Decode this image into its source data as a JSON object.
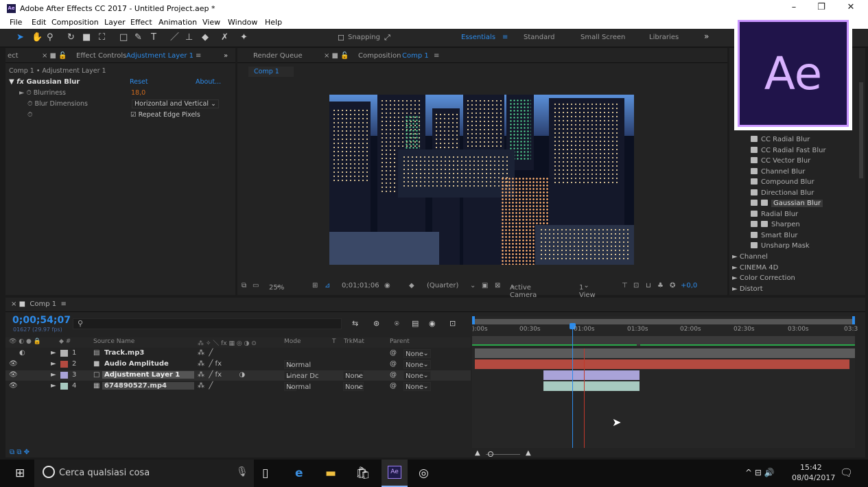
{
  "window": {
    "title": "Adobe After Effects CC 2017 - Untitled Project.aep *",
    "app_badge": "Ae",
    "min": "–",
    "max": "❐",
    "close": "✕"
  },
  "menu": [
    "File",
    "Edit",
    "Composition",
    "Layer",
    "Effect",
    "Animation",
    "View",
    "Window",
    "Help"
  ],
  "toolbar": {
    "snapping": "Snapping",
    "workspaces": [
      "Essentials",
      "Standard",
      "Small Screen",
      "Libraries"
    ],
    "overflow": "»"
  },
  "effect_controls": {
    "tab_prefix": "ect",
    "tab_label": "Effect Controls",
    "tab_layer": "Adjustment Layer 1",
    "overflow": "»",
    "breadcrumb": "Comp 1 • Adjustment Layer 1",
    "effect_name": "Gaussian Blur",
    "reset": "Reset",
    "about": "About...",
    "blurriness_label": "Blurriness",
    "blurriness_value": "18,0",
    "blur_dim_label": "Blur Dimensions",
    "blur_dim_value": "Horizontal and Vertical",
    "repeat_edge": "Repeat Edge Pixels"
  },
  "composition": {
    "render_queue": "Render Queue",
    "tab_label": "Composition",
    "comp_name": "Comp 1",
    "sub_tab": "Comp 1",
    "zoom": "25%",
    "timecode": "0;01;01;06",
    "resolution": "(Quarter)",
    "camera": "Active Camera",
    "views": "1 View",
    "exposure": "+0,0"
  },
  "effects_panel": {
    "items": [
      "CC Radial Blur",
      "CC Radial Fast Blur",
      "CC Vector Blur",
      "Channel Blur",
      "Compound Blur",
      "Directional Blur",
      "Gaussian Blur",
      "Radial Blur",
      "Sharpen",
      "Smart Blur",
      "Unsharp Mask"
    ],
    "categories": [
      "Channel",
      "CINEMA 4D",
      "Color Correction",
      "Distort"
    ]
  },
  "logo": {
    "text": "Ae"
  },
  "timeline": {
    "tab": "Comp 1",
    "timecode": "0;00;54;07",
    "frame_info": "01627 (29.97 fps)",
    "col_source": "Source Name",
    "col_mode": "Mode",
    "col_t": "T",
    "col_trkmat": "TrkMat",
    "col_parent": "Parent",
    "layers": [
      {
        "num": "1",
        "name": "Track.mp3",
        "mode": "",
        "trkmat": "",
        "parent": "None"
      },
      {
        "num": "2",
        "name": "Audio Amplitude",
        "mode": "Normal",
        "trkmat": "",
        "parent": "None"
      },
      {
        "num": "3",
        "name": "Adjustment Layer 1",
        "mode": "Linear Dc",
        "trkmat": "None",
        "parent": "None"
      },
      {
        "num": "4",
        "name": "674890527.mp4",
        "mode": "Normal",
        "trkmat": "None",
        "parent": "None"
      }
    ],
    "ruler": [
      "):00s",
      "00:30s",
      "01:00s",
      "01:30s",
      "02:00s",
      "02:30s",
      "03:00s",
      "03:3"
    ]
  },
  "taskbar": {
    "search": "Cerca qualsiasi cosa",
    "time": "15:42",
    "date": "08/04/2017",
    "ae_icon": "Ae"
  },
  "colors": {
    "accent": "#2d8ceb",
    "orange": "#ce6a1d",
    "label_red": "#b34a40",
    "label_purple": "#a9a3d8",
    "label_teal": "#a7c9c0"
  }
}
